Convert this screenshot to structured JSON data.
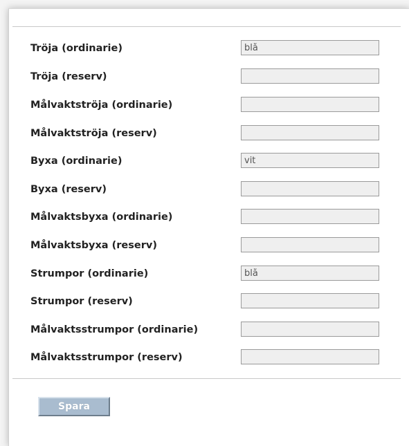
{
  "form": {
    "fields": [
      {
        "label": "Tröja (ordinarie)",
        "value": "blå"
      },
      {
        "label": "Tröja (reserv)",
        "value": ""
      },
      {
        "label": "Målvaktströja (ordinarie)",
        "value": ""
      },
      {
        "label": "Målvaktströja (reserv)",
        "value": ""
      },
      {
        "label": "Byxa (ordinarie)",
        "value": "vit"
      },
      {
        "label": "Byxa (reserv)",
        "value": ""
      },
      {
        "label": "Målvaktsbyxa (ordinarie)",
        "value": ""
      },
      {
        "label": "Målvaktsbyxa (reserv)",
        "value": ""
      },
      {
        "label": "Strumpor (ordinarie)",
        "value": "blå"
      },
      {
        "label": "Strumpor (reserv)",
        "value": ""
      },
      {
        "label": "Målvaktsstrumpor (ordinarie)",
        "value": ""
      },
      {
        "label": "Målvaktsstrumpor (reserv)",
        "value": ""
      }
    ],
    "save_label": "Spara"
  }
}
